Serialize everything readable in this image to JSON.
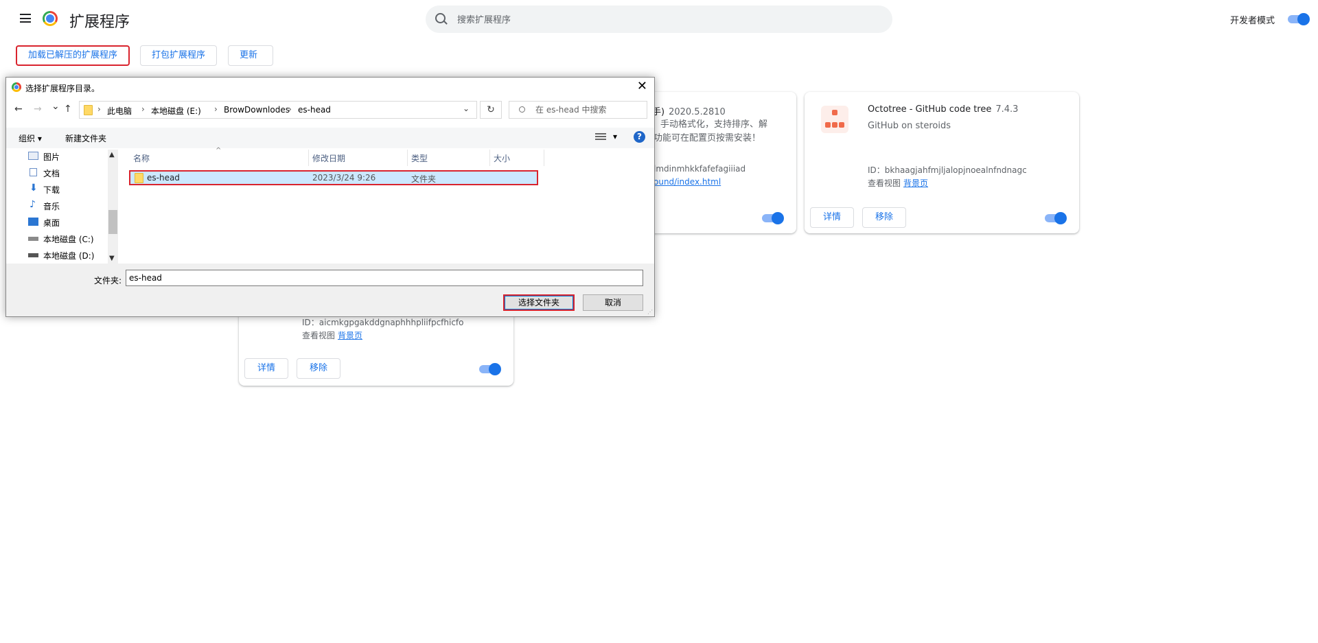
{
  "header": {
    "title": "扩展程序",
    "search_placeholder": "搜索扩展程序",
    "dev_mode_label": "开发者模式"
  },
  "toolbar": {
    "load_unpacked": "加载已解压的扩展程序",
    "pack": "打包扩展程序",
    "update": "更新"
  },
  "cards": {
    "partial": {
      "name_tail": "手)",
      "version": "2020.5.2810",
      "desc_line1": "手动格式化，支持排序、解",
      "desc_line2": "功能可在配置页按需安装！",
      "id_tail": "lmdinmhkkfafefagiiiad",
      "bg_link_tail": "ound/index.html"
    },
    "octotree": {
      "name": "Octotree - GitHub code tree",
      "version": "7.4.3",
      "desc": "GitHub on steroids",
      "id": "ID：bkhaagjahfmjljalopjnoealnfndnagc",
      "view_label": "查看视图",
      "bg_link": "背景页",
      "details": "详情",
      "remove": "移除"
    },
    "third": {
      "id": "ID：aicmkgpgakddgnaphhhpliifpcfhicfo",
      "view_label": "查看视图",
      "bg_link": "背景页",
      "details": "详情",
      "remove": "移除"
    }
  },
  "dialog": {
    "title": "选择扩展程序目录。",
    "close": "✕",
    "nav": {
      "back": "←",
      "forward": "→",
      "recent": "⌄",
      "up": "↑"
    },
    "breadcrumbs": [
      "此电脑",
      "本地磁盘 (E:)",
      "BrowDownlodes",
      "es-head"
    ],
    "refresh": "↻",
    "search_placeholder": "在 es-head 中搜索",
    "commands": {
      "organize": "组织 ▾",
      "new_folder": "新建文件夹",
      "view_arrow": "▾",
      "help": "?"
    },
    "sidebar": [
      {
        "label": "图片",
        "icon": "pictures-icon"
      },
      {
        "label": "文档",
        "icon": "documents-icon"
      },
      {
        "label": "下载",
        "icon": "download-icon"
      },
      {
        "label": "音乐",
        "icon": "music-icon"
      },
      {
        "label": "桌面",
        "icon": "desktop-icon"
      },
      {
        "label": "本地磁盘 (C:)",
        "icon": "drive-icon"
      },
      {
        "label": "本地磁盘 (D:)",
        "icon": "drive-icon"
      }
    ],
    "columns": {
      "name": "名称",
      "modified": "修改日期",
      "type": "类型",
      "size": "大小"
    },
    "files": [
      {
        "name": "es-head",
        "modified": "2023/3/24 9:26",
        "type": "文件夹",
        "size": ""
      }
    ],
    "folder_label": "文件夹:",
    "folder_value": "es-head",
    "select_button": "选择文件夹",
    "cancel_button": "取消"
  },
  "colors": {
    "accent": "#1a73e8",
    "highlight_border": "#d9232d",
    "selection": "#cce8ff"
  }
}
